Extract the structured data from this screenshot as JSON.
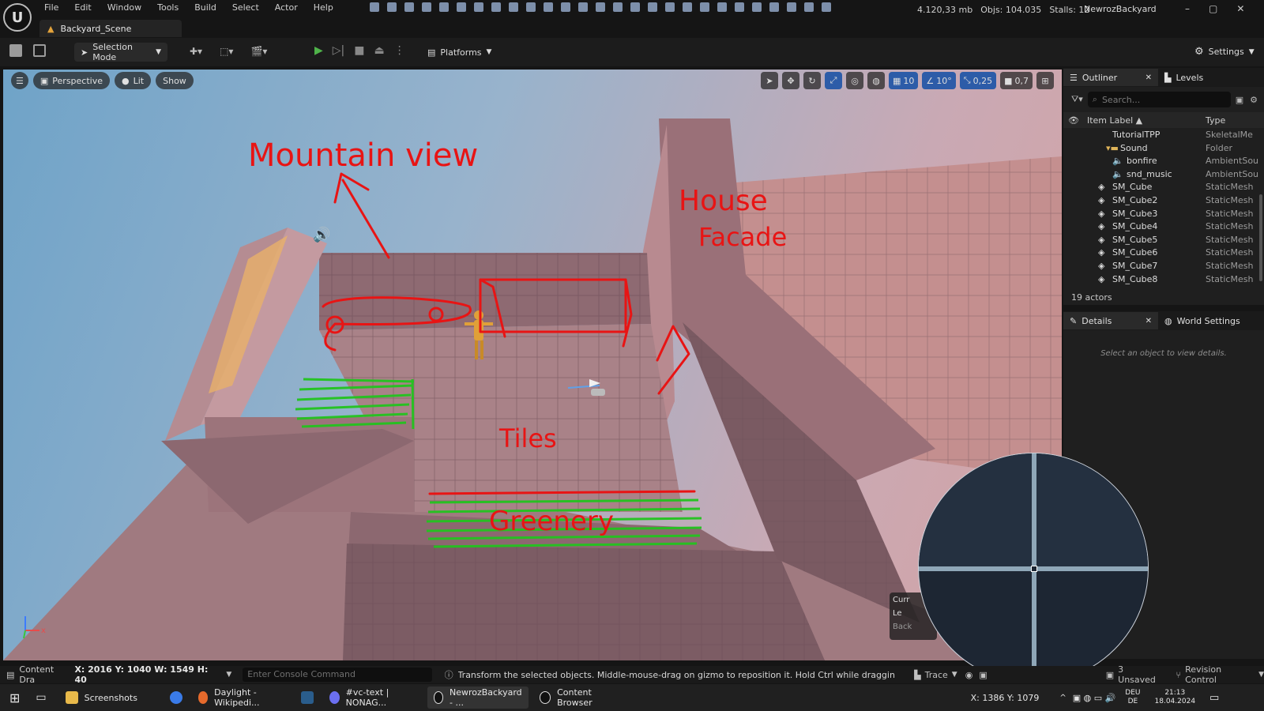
{
  "app": {
    "logo_text": "U",
    "menu": [
      "File",
      "Edit",
      "Window",
      "Tools",
      "Build",
      "Select",
      "Actor",
      "Help"
    ],
    "stats": {
      "memory": "4.120,33 mb",
      "objs": "Objs: 104.035",
      "stalls": "Stalls: 12"
    },
    "project_name": "NewrozBackyard",
    "tab_title": "Backyard_Scene",
    "window_controls": {
      "minimize": "–",
      "maximize": "▢",
      "close": "✕"
    }
  },
  "toolbar": {
    "selection_mode": "Selection Mode",
    "platforms": "Platforms",
    "settings": "Settings"
  },
  "viewport": {
    "perspective": "Perspective",
    "lit": "Lit",
    "show": "Show",
    "grid_value": "10",
    "angle_value": "10°",
    "scale_value": "0,25",
    "camera_speed": "0,7",
    "annotations": {
      "mountain": "Mountain view",
      "house_1": "House",
      "house_2": "Facade",
      "tiles": "Tiles",
      "greenery": "Greenery"
    },
    "axis_x": "x",
    "overlay_line1": "Curr",
    "overlay_line2": "Le",
    "overlay_line3": "Back"
  },
  "outliner": {
    "title": "Outliner",
    "levels_tab": "Levels",
    "search_placeholder": "Search...",
    "col_label": "Item Label ▲",
    "col_type": "Type",
    "rows": [
      {
        "label": "TutorialTPP",
        "type": "SkeletalMe"
      },
      {
        "label": "Sound",
        "type": "Folder"
      },
      {
        "label": "bonfire",
        "type": "AmbientSou"
      },
      {
        "label": "snd_music",
        "type": "AmbientSou"
      },
      {
        "label": "SM_Cube",
        "type": "StaticMesh"
      },
      {
        "label": "SM_Cube2",
        "type": "StaticMesh"
      },
      {
        "label": "SM_Cube3",
        "type": "StaticMesh"
      },
      {
        "label": "SM_Cube4",
        "type": "StaticMesh"
      },
      {
        "label": "SM_Cube5",
        "type": "StaticMesh"
      },
      {
        "label": "SM_Cube6",
        "type": "StaticMesh"
      },
      {
        "label": "SM_Cube7",
        "type": "StaticMesh"
      },
      {
        "label": "SM_Cube8",
        "type": "StaticMesh"
      }
    ],
    "count": "19 actors"
  },
  "details": {
    "title": "Details",
    "world_tab": "World Settings",
    "empty_msg": "Select an object to view details."
  },
  "statusbar": {
    "content_drawer": "Content Dra",
    "coords": "X: 2016 Y: 1040 W: 1549 H: 40",
    "console_placeholder": "Enter Console Command",
    "hint": "Transform the selected objects. Middle-mouse-drag on gizmo to reposition it. Hold Ctrl while dragging to snap/align.",
    "trace": "Trace",
    "unsaved": "3 Unsaved",
    "revision": "Revision Control"
  },
  "taskbar": {
    "items": [
      "Screenshots",
      "Daylight - Wikipedi...",
      "#vc-text | NONAG...",
      "NewrozBackyard - ...",
      "Content Browser"
    ],
    "mouse_coords": "X: 1386 Y: 1079",
    "lang1": "DEU",
    "lang2": "DE",
    "time": "21:13",
    "date": "18.04.2024"
  },
  "colors": {
    "accent": "#2d5ca8",
    "annotation_red": "#e81414",
    "annotation_green": "#22c41e",
    "play_green": "#4fb34a"
  }
}
